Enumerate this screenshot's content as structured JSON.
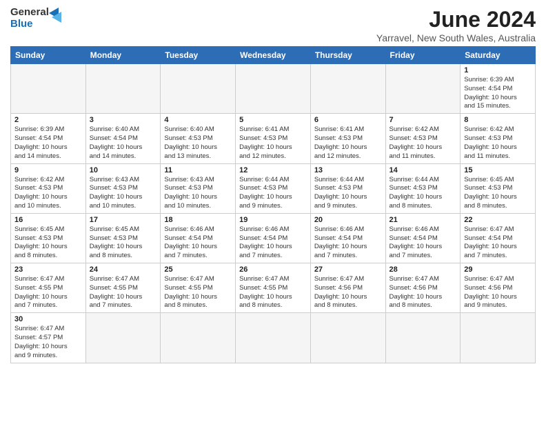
{
  "header": {
    "logo_general": "General",
    "logo_blue": "Blue",
    "month_title": "June 2024",
    "location": "Yarravel, New South Wales, Australia"
  },
  "weekdays": [
    "Sunday",
    "Monday",
    "Tuesday",
    "Wednesday",
    "Thursday",
    "Friday",
    "Saturday"
  ],
  "weeks": [
    [
      {
        "day": "",
        "info": ""
      },
      {
        "day": "",
        "info": ""
      },
      {
        "day": "",
        "info": ""
      },
      {
        "day": "",
        "info": ""
      },
      {
        "day": "",
        "info": ""
      },
      {
        "day": "",
        "info": ""
      },
      {
        "day": "1",
        "info": "Sunrise: 6:39 AM\nSunset: 4:54 PM\nDaylight: 10 hours\nand 15 minutes."
      }
    ],
    [
      {
        "day": "2",
        "info": "Sunrise: 6:39 AM\nSunset: 4:54 PM\nDaylight: 10 hours\nand 14 minutes."
      },
      {
        "day": "3",
        "info": "Sunrise: 6:40 AM\nSunset: 4:54 PM\nDaylight: 10 hours\nand 14 minutes."
      },
      {
        "day": "4",
        "info": "Sunrise: 6:40 AM\nSunset: 4:53 PM\nDaylight: 10 hours\nand 13 minutes."
      },
      {
        "day": "5",
        "info": "Sunrise: 6:41 AM\nSunset: 4:53 PM\nDaylight: 10 hours\nand 12 minutes."
      },
      {
        "day": "6",
        "info": "Sunrise: 6:41 AM\nSunset: 4:53 PM\nDaylight: 10 hours\nand 12 minutes."
      },
      {
        "day": "7",
        "info": "Sunrise: 6:42 AM\nSunset: 4:53 PM\nDaylight: 10 hours\nand 11 minutes."
      },
      {
        "day": "8",
        "info": "Sunrise: 6:42 AM\nSunset: 4:53 PM\nDaylight: 10 hours\nand 11 minutes."
      }
    ],
    [
      {
        "day": "9",
        "info": "Sunrise: 6:42 AM\nSunset: 4:53 PM\nDaylight: 10 hours\nand 10 minutes."
      },
      {
        "day": "10",
        "info": "Sunrise: 6:43 AM\nSunset: 4:53 PM\nDaylight: 10 hours\nand 10 minutes."
      },
      {
        "day": "11",
        "info": "Sunrise: 6:43 AM\nSunset: 4:53 PM\nDaylight: 10 hours\nand 10 minutes."
      },
      {
        "day": "12",
        "info": "Sunrise: 6:44 AM\nSunset: 4:53 PM\nDaylight: 10 hours\nand 9 minutes."
      },
      {
        "day": "13",
        "info": "Sunrise: 6:44 AM\nSunset: 4:53 PM\nDaylight: 10 hours\nand 9 minutes."
      },
      {
        "day": "14",
        "info": "Sunrise: 6:44 AM\nSunset: 4:53 PM\nDaylight: 10 hours\nand 8 minutes."
      },
      {
        "day": "15",
        "info": "Sunrise: 6:45 AM\nSunset: 4:53 PM\nDaylight: 10 hours\nand 8 minutes."
      }
    ],
    [
      {
        "day": "16",
        "info": "Sunrise: 6:45 AM\nSunset: 4:53 PM\nDaylight: 10 hours\nand 8 minutes."
      },
      {
        "day": "17",
        "info": "Sunrise: 6:45 AM\nSunset: 4:53 PM\nDaylight: 10 hours\nand 8 minutes."
      },
      {
        "day": "18",
        "info": "Sunrise: 6:46 AM\nSunset: 4:54 PM\nDaylight: 10 hours\nand 7 minutes."
      },
      {
        "day": "19",
        "info": "Sunrise: 6:46 AM\nSunset: 4:54 PM\nDaylight: 10 hours\nand 7 minutes."
      },
      {
        "day": "20",
        "info": "Sunrise: 6:46 AM\nSunset: 4:54 PM\nDaylight: 10 hours\nand 7 minutes."
      },
      {
        "day": "21",
        "info": "Sunrise: 6:46 AM\nSunset: 4:54 PM\nDaylight: 10 hours\nand 7 minutes."
      },
      {
        "day": "22",
        "info": "Sunrise: 6:47 AM\nSunset: 4:54 PM\nDaylight: 10 hours\nand 7 minutes."
      }
    ],
    [
      {
        "day": "23",
        "info": "Sunrise: 6:47 AM\nSunset: 4:55 PM\nDaylight: 10 hours\nand 7 minutes."
      },
      {
        "day": "24",
        "info": "Sunrise: 6:47 AM\nSunset: 4:55 PM\nDaylight: 10 hours\nand 7 minutes."
      },
      {
        "day": "25",
        "info": "Sunrise: 6:47 AM\nSunset: 4:55 PM\nDaylight: 10 hours\nand 8 minutes."
      },
      {
        "day": "26",
        "info": "Sunrise: 6:47 AM\nSunset: 4:55 PM\nDaylight: 10 hours\nand 8 minutes."
      },
      {
        "day": "27",
        "info": "Sunrise: 6:47 AM\nSunset: 4:56 PM\nDaylight: 10 hours\nand 8 minutes."
      },
      {
        "day": "28",
        "info": "Sunrise: 6:47 AM\nSunset: 4:56 PM\nDaylight: 10 hours\nand 8 minutes."
      },
      {
        "day": "29",
        "info": "Sunrise: 6:47 AM\nSunset: 4:56 PM\nDaylight: 10 hours\nand 9 minutes."
      }
    ],
    [
      {
        "day": "30",
        "info": "Sunrise: 6:47 AM\nSunset: 4:57 PM\nDaylight: 10 hours\nand 9 minutes."
      },
      {
        "day": "",
        "info": ""
      },
      {
        "day": "",
        "info": ""
      },
      {
        "day": "",
        "info": ""
      },
      {
        "day": "",
        "info": ""
      },
      {
        "day": "",
        "info": ""
      },
      {
        "day": "",
        "info": ""
      }
    ]
  ]
}
